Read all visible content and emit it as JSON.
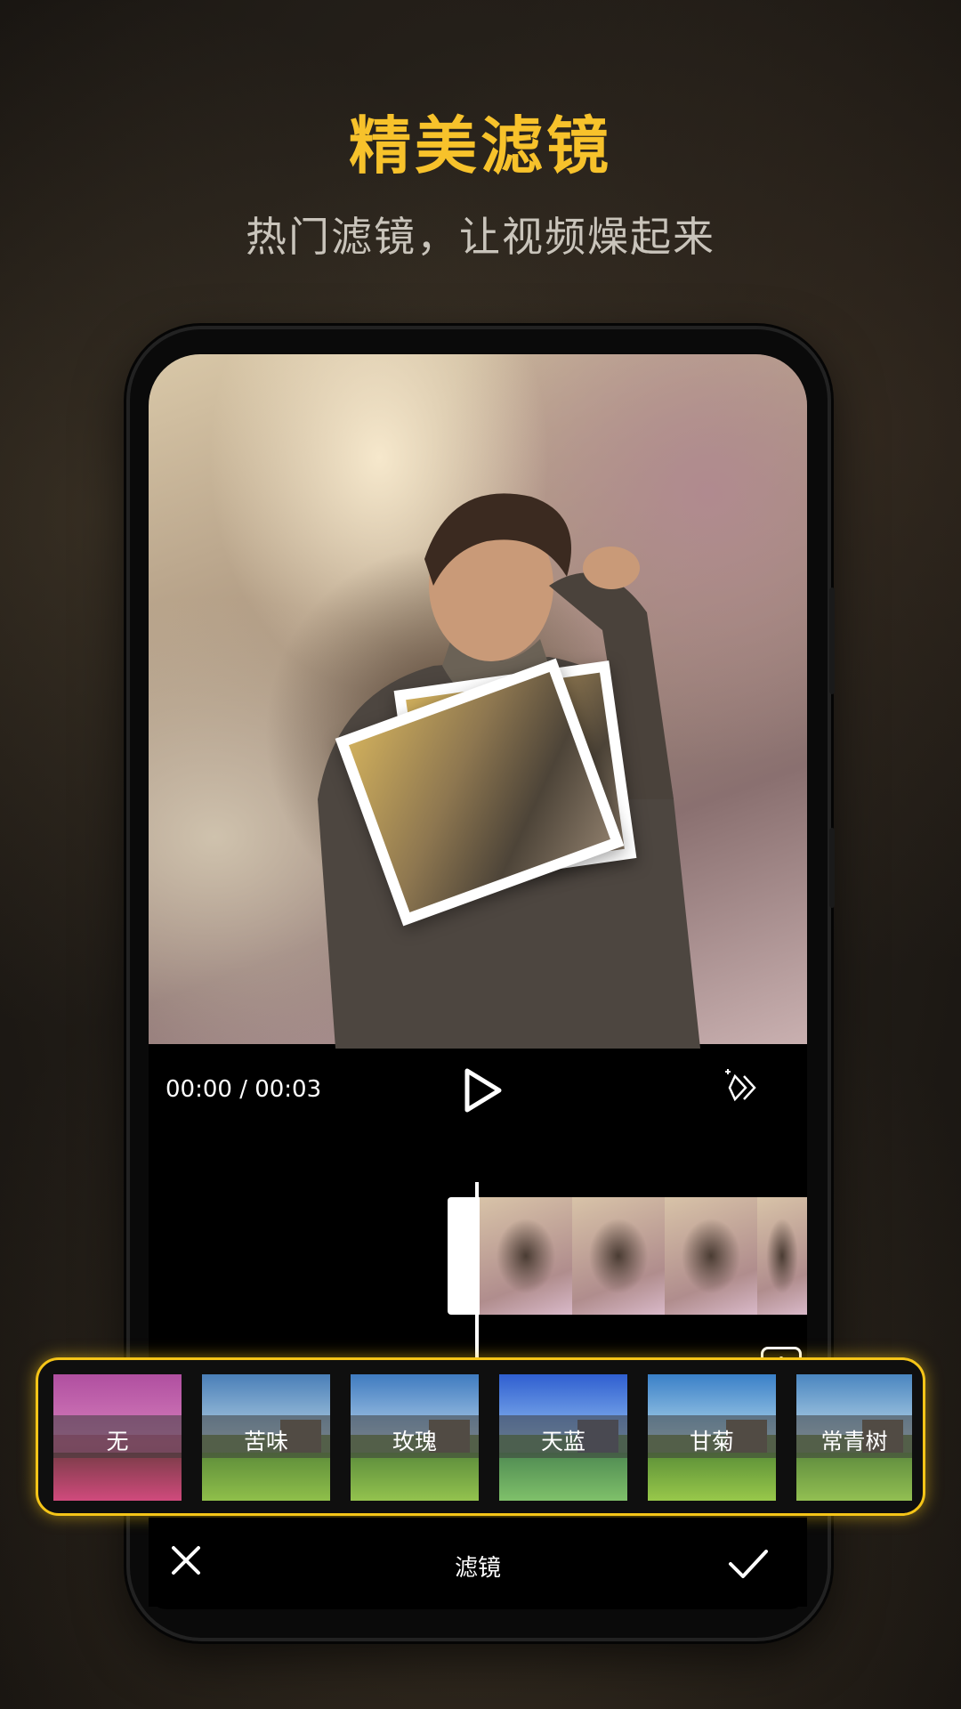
{
  "promo": {
    "headline": "精美滤镜",
    "subline": "热门滤镜，让视频燥起来"
  },
  "player": {
    "timecode": "00:00 / 00:03",
    "play_icon": "play-icon",
    "magic_icon": "magic-wand-icon",
    "add_icon": "add-icon"
  },
  "filters": [
    {
      "label": "无"
    },
    {
      "label": "苦味"
    },
    {
      "label": "玫瑰"
    },
    {
      "label": "天蓝"
    },
    {
      "label": "甘菊"
    },
    {
      "label": "常青树"
    }
  ],
  "bottom_bar": {
    "title": "滤镜",
    "close_icon": "close-icon",
    "confirm_icon": "check-icon"
  },
  "colors": {
    "accent": "#f5c518",
    "headline": "#f7c22b"
  }
}
